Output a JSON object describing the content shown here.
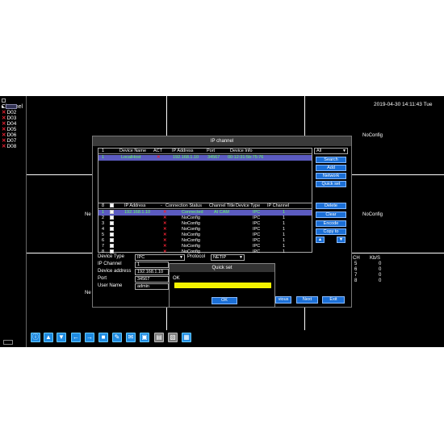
{
  "channel_panel": {
    "header": "Channel",
    "items": [
      {
        "label": "D01",
        "selected": true
      },
      {
        "label": "D02"
      },
      {
        "label": "D03"
      },
      {
        "label": "D04"
      },
      {
        "label": "D05"
      },
      {
        "label": "D06"
      },
      {
        "label": "D07"
      },
      {
        "label": "D08"
      }
    ]
  },
  "status": {
    "datetime": "2019-04-30 14:11:43 Tue",
    "noconfig_1": "NoConfig",
    "noconfig_2": "NoConfig",
    "noconfig_left": "Ne",
    "noconfig_left2": "Ne",
    "stats_ch": "CH",
    "stats_kb": "Kb/S",
    "stats": [
      {
        "ch": "5",
        "kb": "0"
      },
      {
        "ch": "6",
        "kb": "0"
      },
      {
        "ch": "7",
        "kb": "0"
      },
      {
        "ch": "8",
        "kb": "0"
      }
    ]
  },
  "ip_channel": {
    "title": "IP channel",
    "search_table": {
      "headers": [
        "1",
        "Device Name",
        "ACT",
        "IP Address",
        "Port",
        "Device Info"
      ],
      "rows": [
        {
          "n": "1",
          "name": "LocalHost",
          "act": "✕",
          "ip": "192.168.1.10",
          "port": "34567",
          "info": "00:12:31:5b:75:76"
        }
      ]
    },
    "filter_value": "All",
    "buttons": {
      "search": "Search",
      "add": "Add",
      "network": "Network",
      "quick_set": "Quick set",
      "delete": "Delete",
      "clear": "Clear",
      "encode": "Encode",
      "copy_to": "Copy to",
      "up": "▲",
      "down": "▼",
      "previous": "vious",
      "next": "Next",
      "exit": "Exit"
    },
    "channel_table": {
      "headers": [
        "8",
        "IP Address",
        "-",
        "Connection Status",
        "Channel Title",
        "Device Type",
        "IP Channel"
      ],
      "rows": [
        {
          "n": "1",
          "ip": "192.168.1.10",
          "status": "Connected",
          "title": "AI CAM",
          "type": "IPC",
          "ch": "1"
        },
        {
          "n": "2",
          "ip": "",
          "status": "NoConfig",
          "title": "",
          "type": "IPC",
          "ch": "1"
        },
        {
          "n": "3",
          "ip": "",
          "status": "NoConfig",
          "title": "",
          "type": "IPC",
          "ch": "1"
        },
        {
          "n": "4",
          "ip": "",
          "status": "NoConfig",
          "title": "",
          "type": "IPC",
          "ch": "1"
        },
        {
          "n": "5",
          "ip": "",
          "status": "NoConfig",
          "title": "",
          "type": "IPC",
          "ch": "1"
        },
        {
          "n": "6",
          "ip": "",
          "status": "NoConfig",
          "title": "",
          "type": "IPC",
          "ch": "1"
        },
        {
          "n": "7",
          "ip": "",
          "status": "NoConfig",
          "title": "",
          "type": "IPC",
          "ch": "1"
        },
        {
          "n": "8",
          "ip": "",
          "status": "NoConfig",
          "title": "",
          "type": "IPC",
          "ch": "1"
        }
      ]
    },
    "form": {
      "device_type_label": "Device Type",
      "device_type_value": "IPC",
      "protocol_label": "Protocol",
      "protocol_value": "NETIP",
      "ip_channel_label": "IP Channel",
      "ip_channel_value": "1",
      "address_label": "Device address",
      "address_value": "192.168.1.10",
      "port_label": "Port",
      "port_value": "34567",
      "user_label": "User Name",
      "user_value": "admin"
    }
  },
  "quick_set": {
    "title": "Quick set",
    "status": "OK",
    "progress": 1.0,
    "ok_button": "OK"
  },
  "colors": {
    "accent": "#1b6fd6",
    "highlight_row": "#5b5bc0",
    "progress": "#f2f200",
    "error": "#e22233"
  }
}
